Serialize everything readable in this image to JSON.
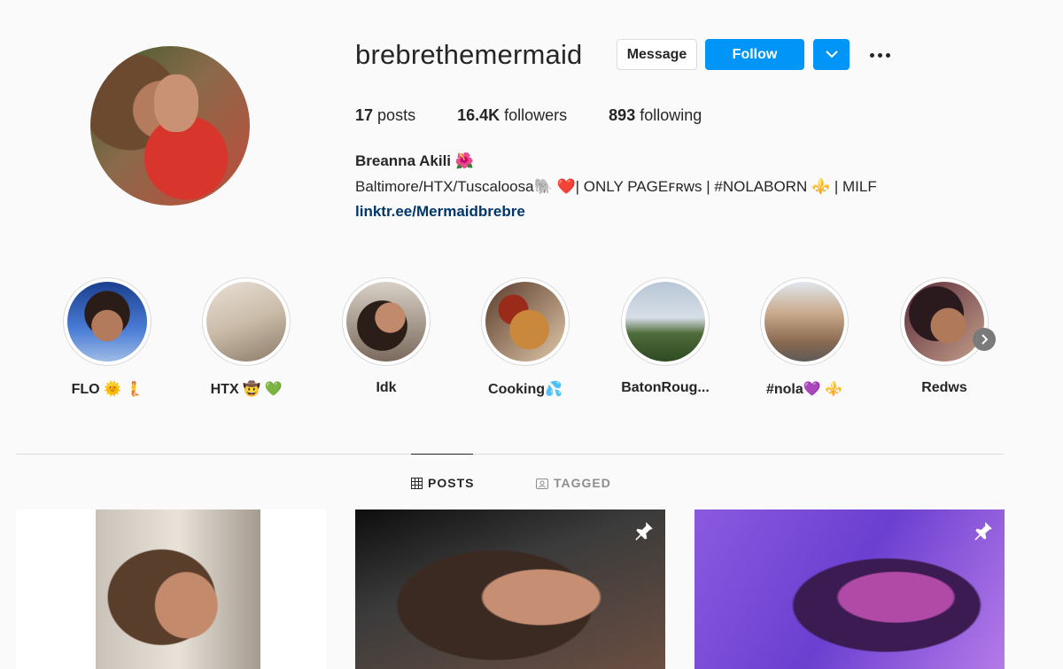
{
  "profile": {
    "username": "brebrethemermaid",
    "full_name": "Breanna Akili 🌺",
    "bio": "Baltimore/HTX/Tuscaloosa🐘 ❤️| ONLY PAGEꜰʀᴡs | #NOLABORN ⚜️ | MILF",
    "link": "linktr.ee/Mermaidbrebre",
    "avatar_icon": "profile-photo"
  },
  "actions": {
    "message_label": "Message",
    "follow_label": "Follow",
    "dropdown_icon": "chevron-down-icon",
    "more_icon": "more-options-icon",
    "accent": "#0095f6"
  },
  "stats": [
    {
      "count": "17",
      "label": "posts"
    },
    {
      "count": "16.4K",
      "label": "followers"
    },
    {
      "count": "893",
      "label": "following"
    }
  ],
  "highlights": [
    {
      "label": "FLO 🌞 🧜"
    },
    {
      "label": "HTX 🤠 💚"
    },
    {
      "label": "Idk"
    },
    {
      "label": "Cooking💦"
    },
    {
      "label": "BatonRoug..."
    },
    {
      "label": "#nola💜 ⚜️"
    },
    {
      "label": "Redws"
    }
  ],
  "highlights_next_icon": "chevron-right-icon",
  "tabs": [
    {
      "label": "POSTS",
      "icon": "grid-icon",
      "active": true
    },
    {
      "label": "TAGGED",
      "icon": "tagged-icon",
      "active": false
    }
  ],
  "posts": [
    {
      "pinned": false
    },
    {
      "pinned": true
    },
    {
      "pinned": true
    }
  ]
}
